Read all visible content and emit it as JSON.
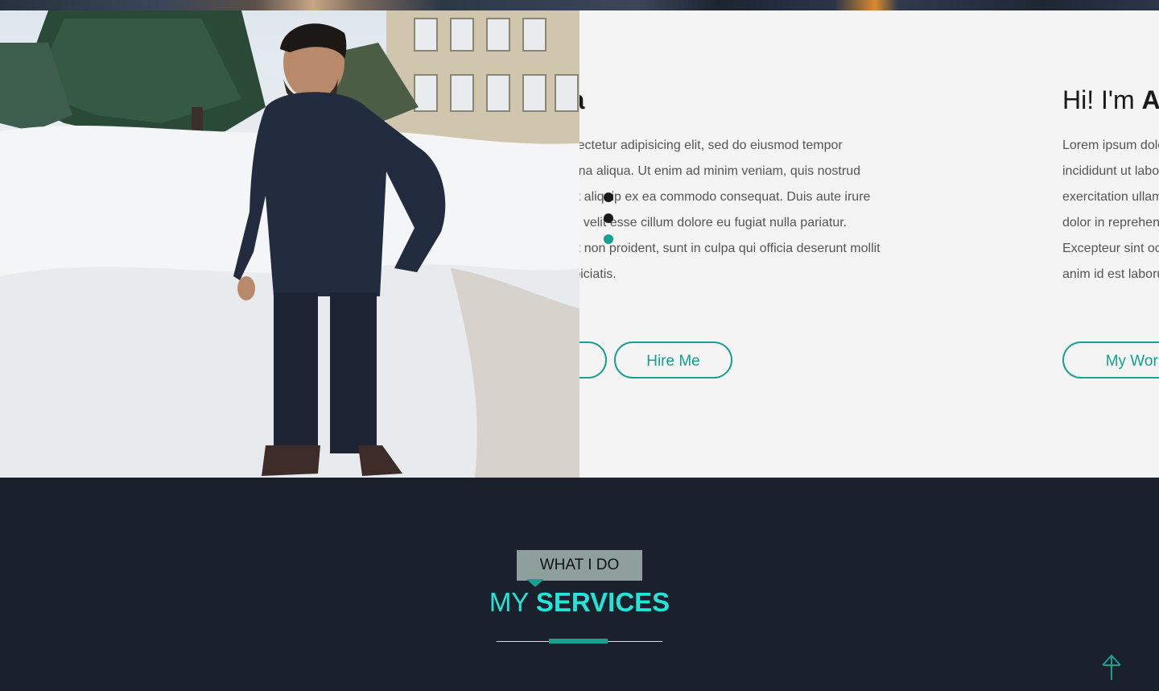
{
  "hero": {
    "greeting": "Hi! I'm ",
    "name": "Aaradhya",
    "name_partial": "aradhya",
    "bio": "Lorem ipsum dolor sit amet, consectetur adipisicing elit, sed do eiusmod tempor incididunt ut labore et dolore magna aliqua. Ut enim ad minim veniam, quis nostrud exercitation ullamco laboris nisi ut aliquip ex ea commodo consequat. Duis aute irure dolor in reprehenderit in voluptate velit esse cillum dolore eu fugiat nulla pariatur. Excepteur sint occaecat cupidatat non proident, sunt in culpa qui officia deserunt mollit anim id est laborum. Sed ut perspiciatis.",
    "my_work_label": "My Work",
    "hire_me_label": "Hire Me"
  },
  "slider": {
    "dot_count": 3,
    "active_dot": 3,
    "accent_color": "#17a191"
  },
  "services": {
    "tag": "WHAT I DO",
    "title_light": "MY ",
    "title_bold": "SERVICES",
    "title_color": "#22e5d8"
  },
  "scroll_top": {
    "icon": "arrow-up-icon"
  },
  "colors": {
    "accent": "#17a191",
    "dark_bg": "#1a212c",
    "hero_bg": "#f4f4f4"
  }
}
